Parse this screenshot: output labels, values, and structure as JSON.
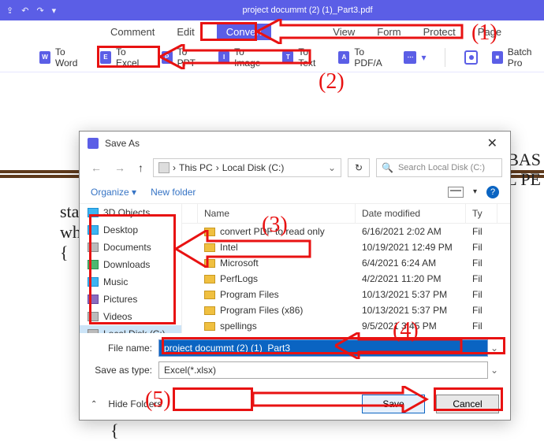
{
  "titlebar": {
    "title": "project docummt (2) (1)_Part3.pdf"
  },
  "tabs": {
    "comment": "Comment",
    "edit": "Edit",
    "convert": "Convert",
    "view": "View",
    "form": "Form",
    "protect": "Protect",
    "page": "Page"
  },
  "toolbar": {
    "to_word": "To Word",
    "to_excel": "To Excel",
    "to_ppt": "To PPT",
    "to_image": "To Image",
    "to_text": "To Text",
    "to_pdfa": "To PDF/A",
    "batch": "Batch Pro"
  },
  "bg": {
    "right1": "RM BAS",
    "right2": "RIAL PE",
    "left1": "stat",
    "left2": "wh",
    "brace": "{",
    "brace2": "{"
  },
  "dialog": {
    "title": "Save As",
    "breadcrumb": {
      "root": "This PC",
      "sep": "›",
      "child": "Local Disk (C:)"
    },
    "search_placeholder": "Search Local Disk (C:)",
    "organize": "Organize ▾",
    "new_folder": "New folder",
    "sidebar": [
      {
        "label": "3D Objects",
        "cls": "blue"
      },
      {
        "label": "Desktop",
        "cls": "blue"
      },
      {
        "label": "Documents",
        "cls": "gray"
      },
      {
        "label": "Downloads",
        "cls": "green"
      },
      {
        "label": "Music",
        "cls": "blue"
      },
      {
        "label": "Pictures",
        "cls": "purple"
      },
      {
        "label": "Videos",
        "cls": "gray"
      },
      {
        "label": "Local Disk (C:)",
        "cls": "gray"
      }
    ],
    "cols": {
      "name": "Name",
      "date": "Date modified",
      "type": "Ty"
    },
    "files": [
      {
        "name": "convert PDF to read only",
        "date": "6/16/2021 2:02 AM",
        "type": "Fil"
      },
      {
        "name": "Intel",
        "date": "10/19/2021 12:49 PM",
        "type": "Fil"
      },
      {
        "name": "Microsoft",
        "date": "6/4/2021 6:24 AM",
        "type": "Fil"
      },
      {
        "name": "PerfLogs",
        "date": "4/2/2021 11:20 PM",
        "type": "Fil"
      },
      {
        "name": "Program Files",
        "date": "10/13/2021 5:37 PM",
        "type": "Fil"
      },
      {
        "name": "Program Files (x86)",
        "date": "10/13/2021 5:37 PM",
        "type": "Fil"
      },
      {
        "name": "spellings",
        "date": "9/5/2021 3:45 PM",
        "type": "Fil"
      }
    ],
    "file_name_label": "File name:",
    "file_name_value": "project docummt (2) (1)_Part3",
    "save_type_label": "Save as type:",
    "save_type_value": "Excel(*.xlsx)",
    "hide": "Hide Folders",
    "save": "Save",
    "cancel": "Cancel"
  },
  "annotations": {
    "n1": "(1)",
    "n2": "(2)",
    "n3": "(3)",
    "n4": "(4)",
    "n5": "(5)"
  }
}
